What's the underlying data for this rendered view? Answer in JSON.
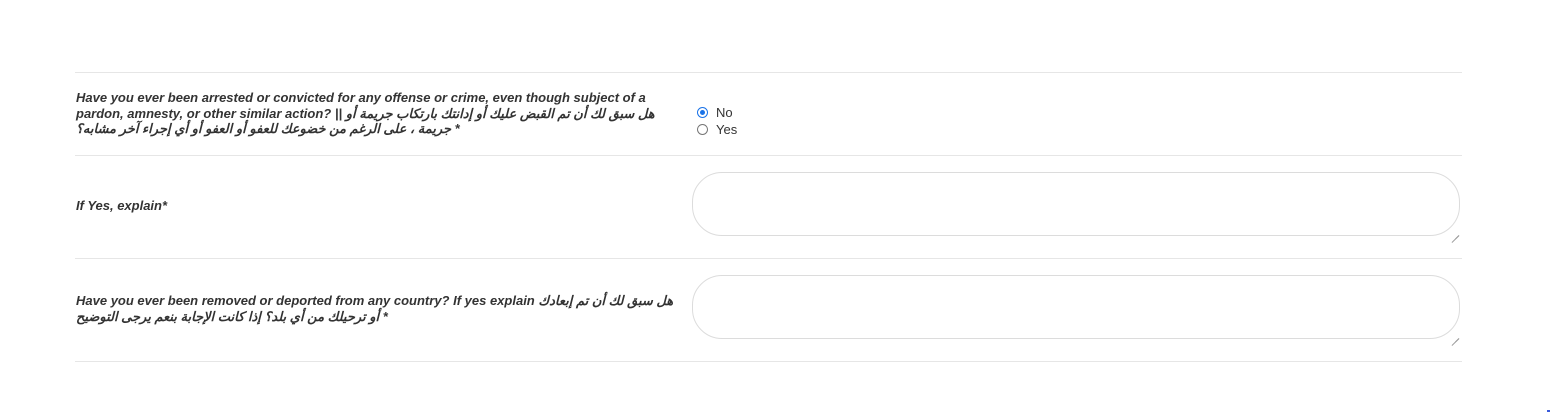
{
  "questions": {
    "arrested": {
      "label": "Have you ever been arrested or convicted for any offense or crime, even though subject of a pardon, amnesty, or other similar action? || هل سبق لك أن تم القبض عليك أو إدانتك بارتكاب جريمة أو جريمة ، على الرغم من خضوعك للعفو أو العفو أو أي إجراء آخر مشابه؟ *",
      "options": [
        {
          "label": "No",
          "selected": true
        },
        {
          "label": "Yes",
          "selected": false
        }
      ]
    },
    "explain": {
      "label": "If Yes, explain*",
      "value": ""
    },
    "deported": {
      "label": "Have you ever been removed or deported from any country? If yes explain هل سبق لك أن تم إبعادك أو ترحيلك من أي بلد؟ إذا كانت الإجابة بنعم يرجى التوضيح *",
      "value": ""
    }
  },
  "colors": {
    "accent": "#1a73e8",
    "divider": "#e6e6e6",
    "text": "#333333"
  }
}
